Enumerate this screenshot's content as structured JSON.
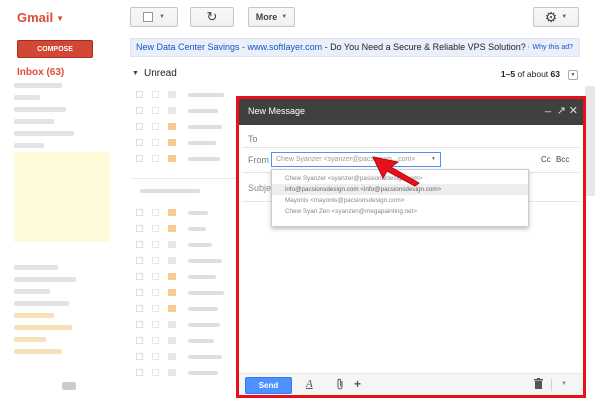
{
  "app": {
    "logo": "Gmail",
    "compose_label": "COMPOSE",
    "inbox_label": "Inbox (63)"
  },
  "toolbar": {
    "refresh_icon": "↻",
    "more_label": "More",
    "settings_icon": "⚙"
  },
  "ad": {
    "link_text": "New Data Center Savings - www.softlayer.com",
    "body_text": " - Do You Need a Secure & Reliable VPS Solution? Ch",
    "why_label": "Why this ad?"
  },
  "inbox_section": {
    "title": "Unread",
    "count_prefix": "1–5",
    "count_suffix": " of about ",
    "count_total": "63"
  },
  "compose": {
    "window_title": "New Message",
    "to_label": "To",
    "from_label": "From",
    "from_value": "Chew Syanzer <syanzer@pacsionals...com>",
    "cc_label": "Cc",
    "bcc_label": "Bcc",
    "subject_label": "Subje",
    "from_options": [
      "Chew Syanzer <syanzer@passionaldesign.com>",
      "info@pacsionsdesign.com <info@pacsionsdesign.com>",
      "Mayonis <mayonis@pacsionsdesign.com>",
      "Chew Syan Zen <syanzen@megapainting.net>"
    ],
    "selected_option_index": 1,
    "send_label": "Send"
  },
  "colors": {
    "brand_red": "#dd4b39",
    "compose_button": "#d14836",
    "highlight_border": "#e8111b",
    "send_blue": "#4d90fe",
    "titlebar": "#404040"
  },
  "icons": {
    "minimize": "minimize-icon",
    "popout": "popout-icon",
    "close": "close-icon",
    "format": "format-text-icon",
    "attach": "paperclip-icon",
    "insert": "plus-icon",
    "trash": "trash-icon",
    "arrow": "red-pointer-arrow-icon"
  }
}
